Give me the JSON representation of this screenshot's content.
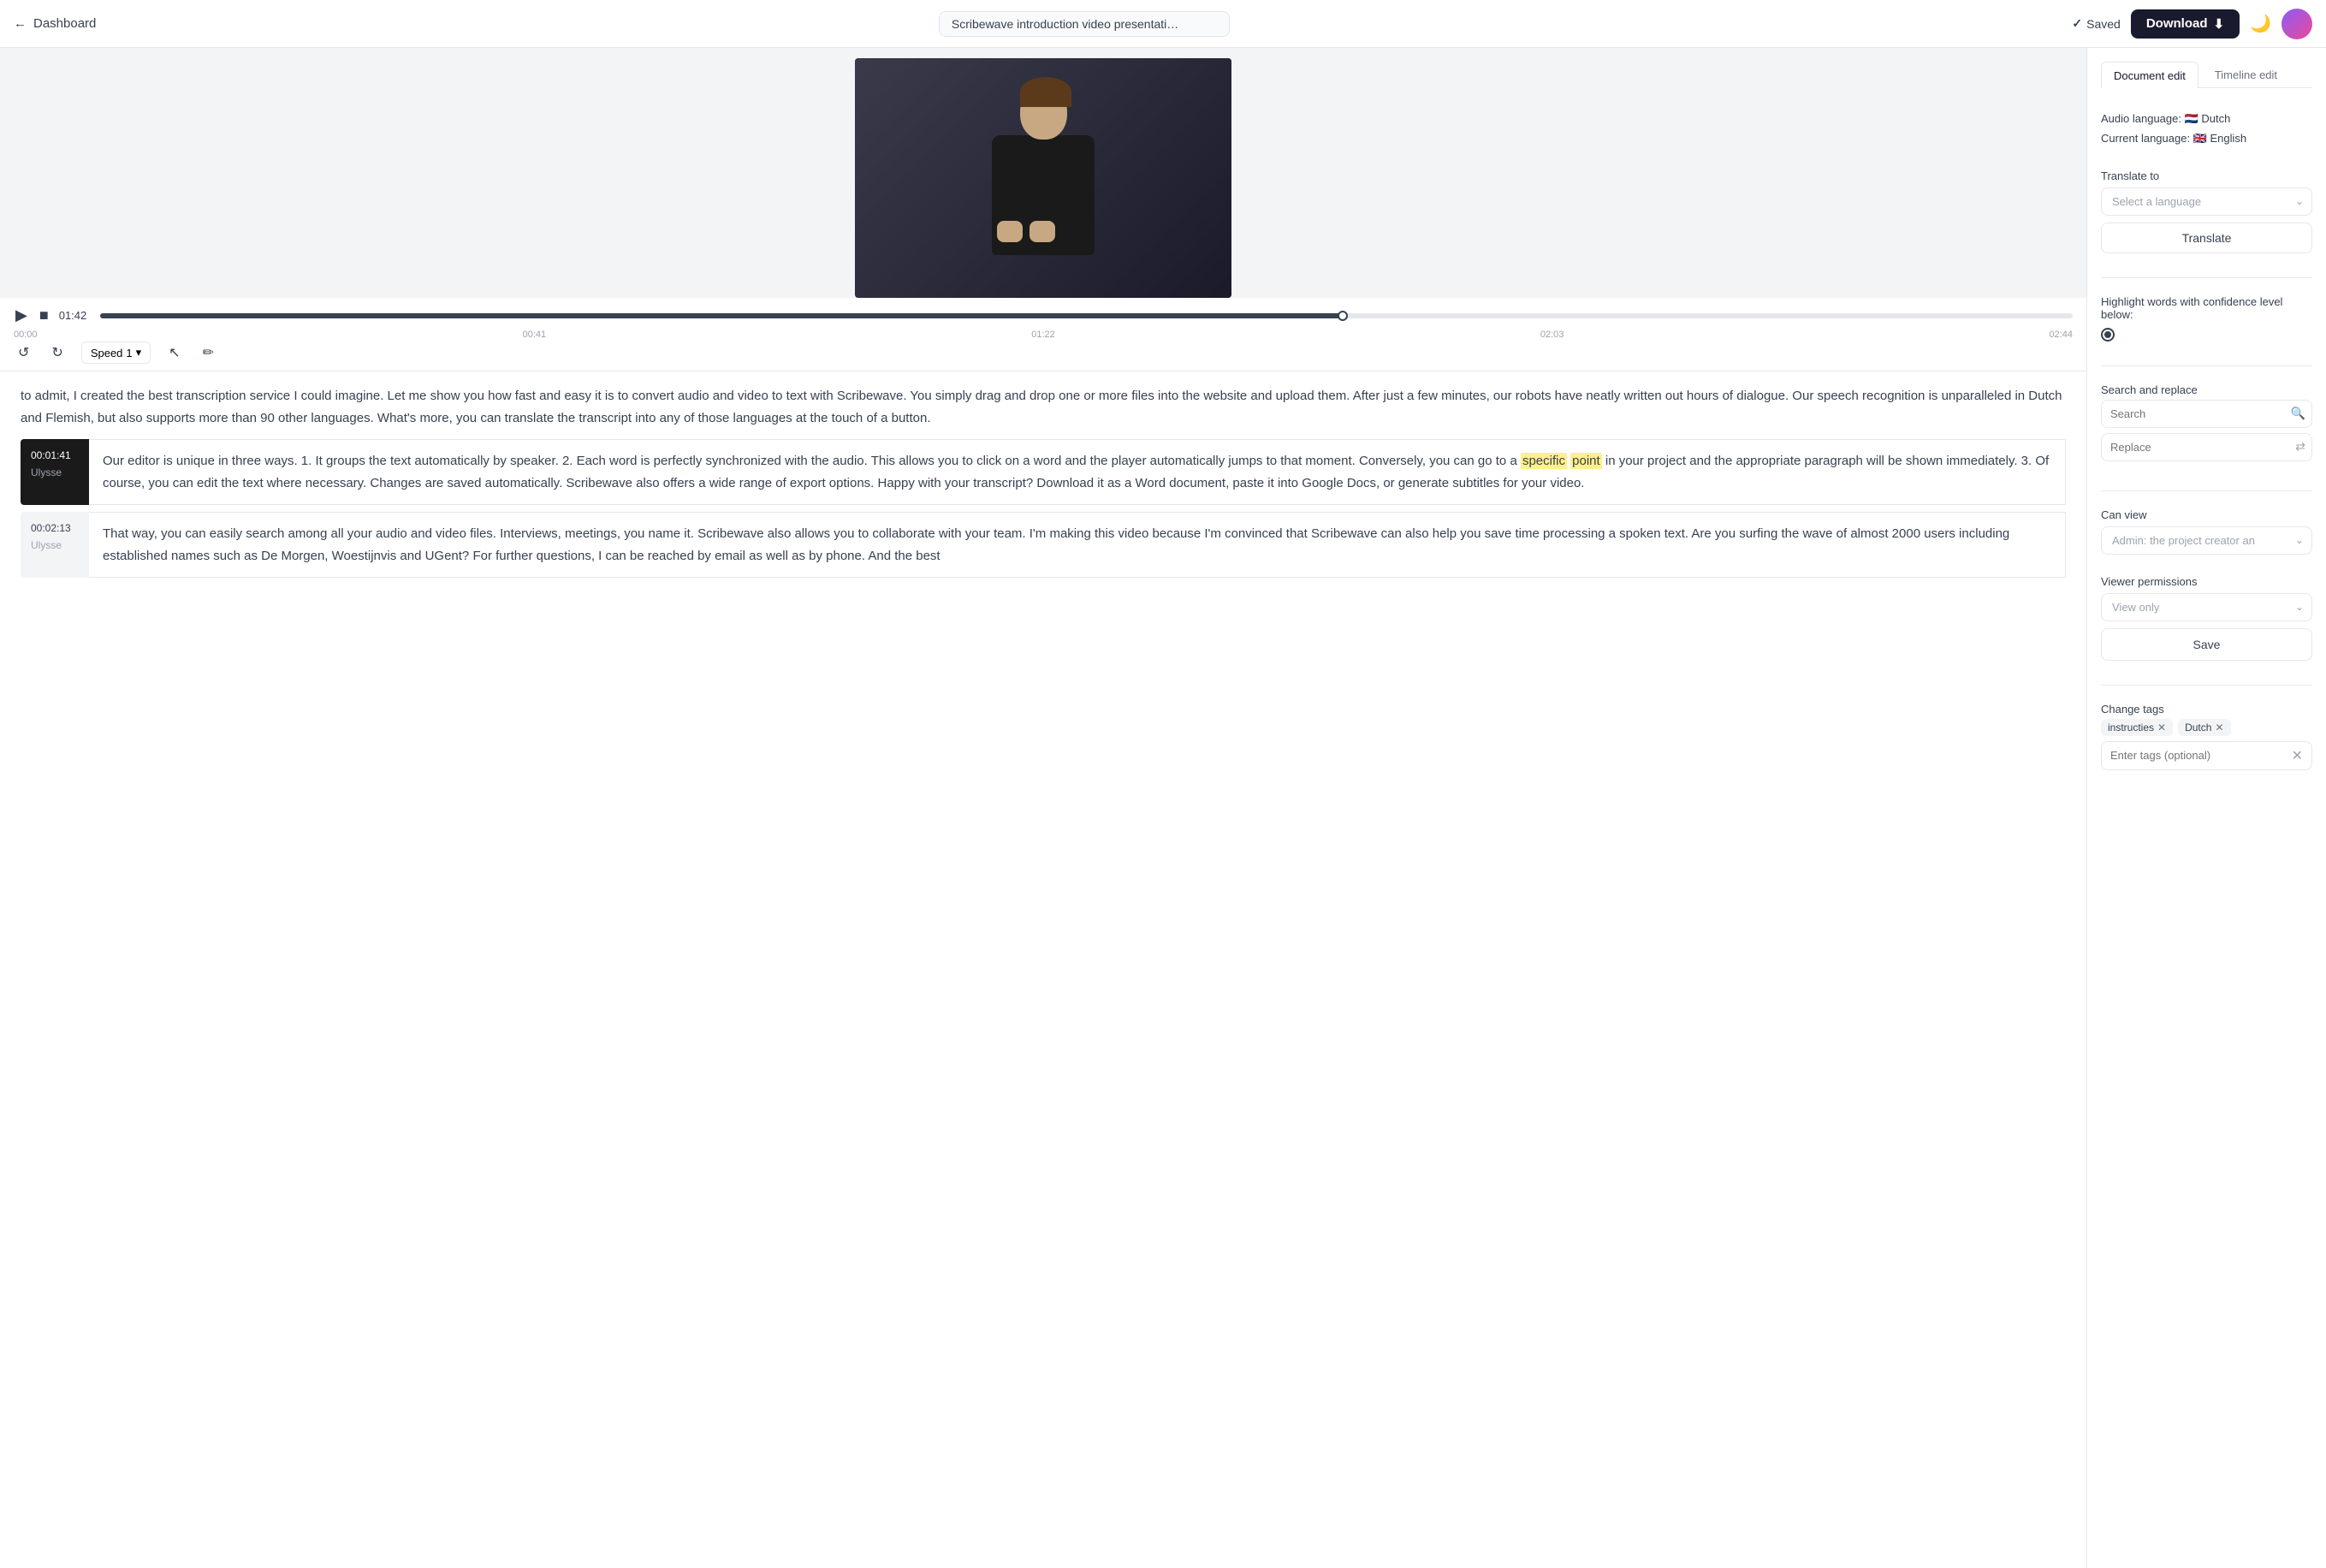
{
  "topbar": {
    "back_label": "Dashboard",
    "title": "Scribewave introduction video presentati…",
    "saved_label": "Saved",
    "download_label": "Download"
  },
  "tabs": {
    "document_edit": "Document edit",
    "timeline_edit": "Timeline edit"
  },
  "sidebar": {
    "audio_language_label": "Audio language:",
    "audio_language_flag": "🇳🇱",
    "audio_language": "Dutch",
    "current_language_label": "Current language:",
    "current_language_flag": "🇬🇧",
    "current_language": "English",
    "translate_to_label": "Translate to",
    "translate_placeholder": "Select a language",
    "translate_btn": "Translate",
    "confidence_label": "Highlight words with confidence level below:",
    "search_replace_label": "Search and replace",
    "search_placeholder": "Search",
    "replace_placeholder": "Replace",
    "can_view_label": "Can view",
    "can_view_value": "Admin: the project creator an",
    "viewer_permissions_label": "Viewer permissions",
    "viewer_permissions_value": "View only",
    "save_btn": "Save",
    "change_tags_label": "Change tags",
    "tags": [
      "instructies",
      "Dutch"
    ],
    "enter_tags_placeholder": "Enter tags (optional)"
  },
  "video": {
    "current_time": "01:42",
    "start_time": "00:00",
    "marker1": "00:41",
    "marker2": "01:22",
    "marker3": "02:03",
    "end_time": "02:44",
    "speed_label": "Speed",
    "speed_value": "1",
    "progress_percent": 63
  },
  "transcript": {
    "paragraph1": "to admit, I created the best transcription service I could imagine. Let me show you how fast and easy it is to convert audio and video to text with Scribewave. You simply drag and drop one or more files into the website and upload them. After just a few minutes, our robots have neatly written out hours of dialogue. Our speech recognition is unparalleled in Dutch and Flemish, but also supports more than 90 other languages. What's more, you can translate the transcript into any of those languages at the touch of a button.",
    "block1": {
      "timestamp": "00:01:41",
      "speaker": "Ulysse",
      "text_before": "Our editor is unique in three ways. 1. It groups the text automatically by speaker. 2. Each word is perfectly synchronized with the audio. This allows you to click on a word and the player automatically jumps to that moment. Conversely, you can go to a ",
      "highlight1": "specific",
      "highlight2": "point",
      "text_after": " in your project and the appropriate paragraph will be shown immediately. 3. Of course, you can edit the text where necessary. Changes are saved automatically. Scribewave also offers a wide range of export options. Happy with your transcript? Download it as a Word document, paste it into Google Docs, or generate subtitles for your video."
    },
    "block2": {
      "timestamp": "00:02:13",
      "speaker": "Ulysse",
      "text": "That way, you can easily search among all your audio and video files. Interviews, meetings, you name it. Scribewave also allows you to collaborate with your team. I'm making this video because I'm convinced that Scribewave can also help you save time processing a spoken text. Are you surfing the wave of almost 2000 users including established names such as De Morgen, Woestijnvis and UGent? For further questions, I can be reached by email as well as by phone. And the best"
    }
  }
}
